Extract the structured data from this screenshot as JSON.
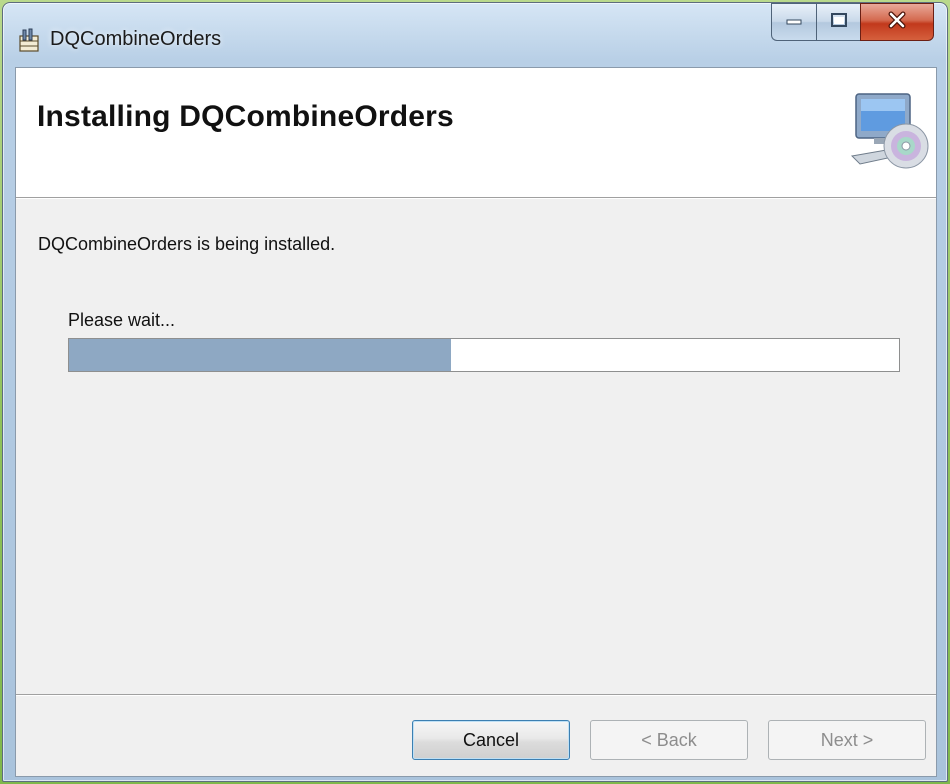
{
  "window": {
    "title": "DQCombineOrders",
    "app_icon": "installer-package-icon",
    "caption_buttons": {
      "minimize_icon": "minimize-icon",
      "maximize_icon": "maximize-icon",
      "close_icon": "close-icon"
    }
  },
  "banner": {
    "title": "Installing DQCombineOrders",
    "graphic_icon": "computer-with-cd-icon"
  },
  "body": {
    "status_text": "DQCombineOrders is being installed.",
    "wait_text": "Please wait...",
    "progress_fraction": 0.46
  },
  "footer": {
    "cancel_label": "Cancel",
    "back_label": "< Back",
    "next_label": "Next >",
    "back_enabled": false,
    "next_enabled": false
  },
  "colors": {
    "progress_fill": "#8ea8c3",
    "dialog_bg": "#f0f0f0",
    "banner_bg": "#ffffff",
    "close_button": "#c2391c"
  }
}
